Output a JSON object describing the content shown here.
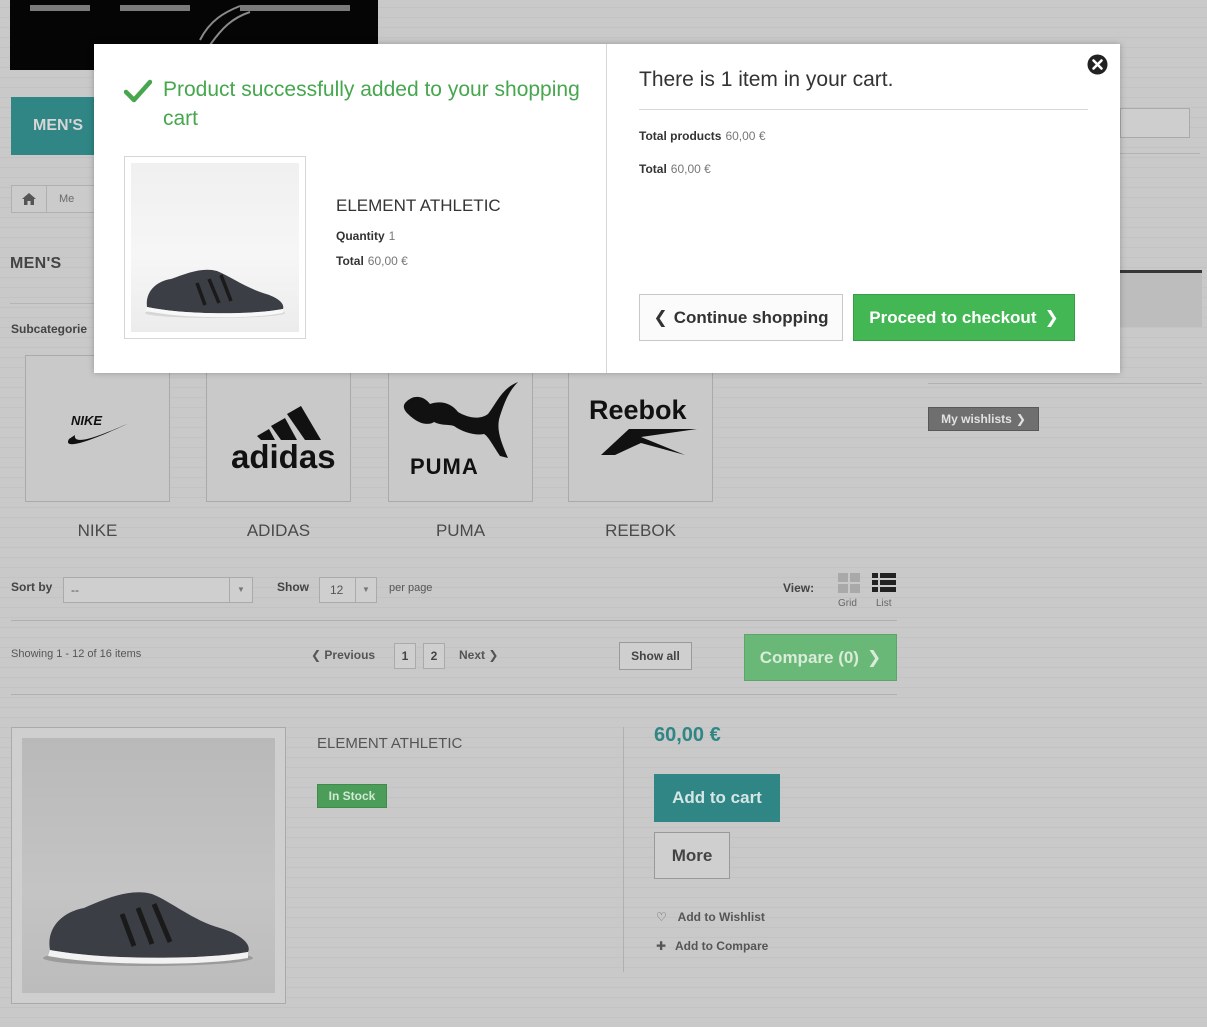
{
  "colors": {
    "teal": "#2f8685",
    "green": "#43b754",
    "success_text": "#46a74e",
    "overlay": "#c9c9c9"
  },
  "header": {
    "menu_item": "MEN'S"
  },
  "category": {
    "title": "MEN'S",
    "subcategories_label": "Subcategorie",
    "brands": [
      {
        "name": "NIKE",
        "logo_text": "NIKE",
        "icon": "nike-swoosh-icon"
      },
      {
        "name": "ADIDAS",
        "logo_text": "adidas",
        "icon": "adidas-stripes-icon"
      },
      {
        "name": "PUMA",
        "logo_text": "PUMA",
        "icon": "puma-cat-icon"
      },
      {
        "name": "REEBOK",
        "logo_text": "Reebok",
        "icon": "reebok-vector-icon"
      }
    ]
  },
  "breadcrumb": {
    "home_icon": "home-icon",
    "item": "Me"
  },
  "sidebar": {
    "wishlist_button": "My wishlists"
  },
  "toolbar": {
    "sort_label": "Sort by",
    "sort_value": "--",
    "show_label": "Show",
    "show_value": "12",
    "per_page": "per page",
    "view_label": "View:",
    "grid_label": "Grid",
    "list_label": "List"
  },
  "pagination": {
    "showing": "Showing 1 - 12 of 16 items",
    "previous": "Previous",
    "pages": [
      "1",
      "2"
    ],
    "next": "Next",
    "show_all": "Show all",
    "compare": "Compare (0)"
  },
  "product": {
    "name": "ELEMENT ATHLETIC",
    "stock": "In Stock",
    "price": "60,00 €",
    "add_to_cart": "Add to cart",
    "more": "More",
    "add_to_wishlist": "Add to Wishlist",
    "add_to_compare": "Add to Compare"
  },
  "modal": {
    "success_message": "Product successfully added to your shopping cart",
    "product_name": "ELEMENT ATHLETIC",
    "quantity_label": "Quantity",
    "quantity_value": "1",
    "total_label": "Total",
    "total_value": "60,00 €",
    "cart_count_text": "There is 1 item in your cart.",
    "total_products_label": "Total products",
    "total_products_value": "60,00 €",
    "cart_total_label": "Total",
    "cart_total_value": "60,00 €",
    "continue_shopping": "Continue shopping",
    "proceed_to_checkout": "Proceed to checkout"
  }
}
